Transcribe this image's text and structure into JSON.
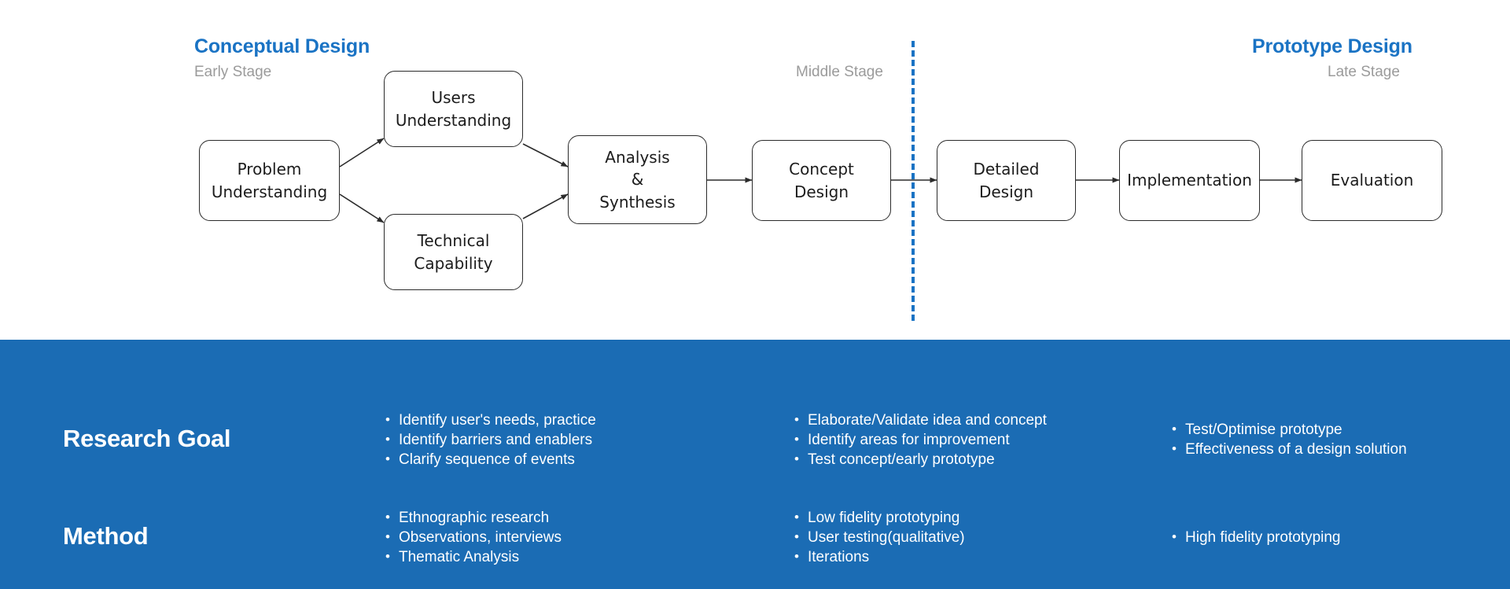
{
  "diagram": {
    "phases": [
      {
        "title": "Conceptual Design",
        "stage": "Early Stage"
      },
      {
        "stage": "Middle Stage"
      },
      {
        "title": "Prototype Design",
        "stage": "Late Stage"
      }
    ],
    "nodes": [
      {
        "id": "problem",
        "label": "Problem\nUnderstanding"
      },
      {
        "id": "users",
        "label": "Users\nUnderstanding"
      },
      {
        "id": "technical",
        "label": "Technical\nCapability"
      },
      {
        "id": "analysis",
        "label": "Analysis\n&\nSynthesis"
      },
      {
        "id": "concept",
        "label": "Concept\nDesign"
      },
      {
        "id": "detailed",
        "label": "Detailed\nDesign"
      },
      {
        "id": "implementation",
        "label": "Implementation"
      },
      {
        "id": "evaluation",
        "label": "Evaluation"
      }
    ]
  },
  "info_panel": {
    "rows": [
      {
        "label": "Research Goal",
        "columns": [
          {
            "stage": "early",
            "items": [
              "Identify user's needs, practice",
              "Identify barriers and enablers",
              "Clarify sequence of events"
            ]
          },
          {
            "stage": "middle",
            "items": [
              "Elaborate/Validate idea and concept",
              "Identify areas for improvement",
              "Test concept/early prototype"
            ]
          },
          {
            "stage": "late",
            "items": [
              "Test/Optimise prototype",
              "Effectiveness of a design solution"
            ]
          }
        ]
      },
      {
        "label": "Method",
        "columns": [
          {
            "stage": "early",
            "items": [
              "Ethnographic research",
              "Observations, interviews",
              "Thematic Analysis"
            ]
          },
          {
            "stage": "middle",
            "items": [
              "Low fidelity prototyping",
              "User testing(qualitative)",
              "Iterations"
            ]
          },
          {
            "stage": "late",
            "items": [
              "High fidelity prototyping"
            ]
          }
        ]
      }
    ]
  },
  "colors": {
    "accent_blue": "#1a73c4",
    "panel_blue": "#1b6cb4",
    "stage_label_gray": "#9b9b9b",
    "node_border": "#2b2b2b",
    "text_white": "#ffffff"
  }
}
